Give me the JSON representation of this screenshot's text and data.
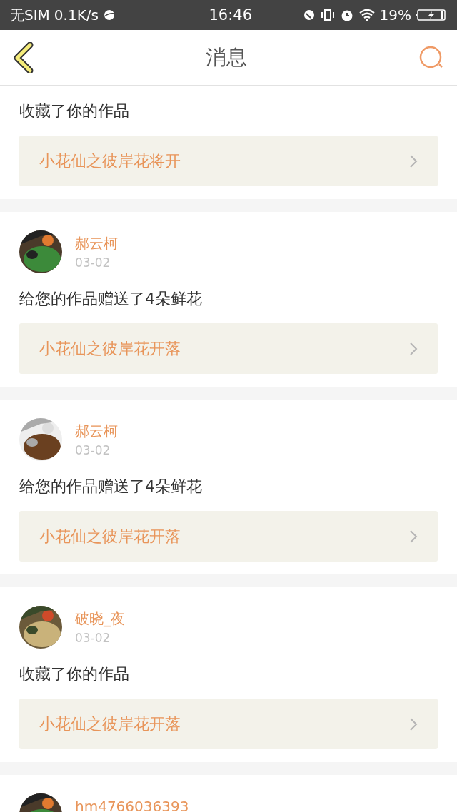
{
  "status_bar": {
    "carrier": "无SIM",
    "speed": "0.1K/s",
    "time": "16:46",
    "battery": "19%"
  },
  "header": {
    "title": "消息"
  },
  "messages": [
    {
      "text": "收藏了你的作品",
      "work": "小花仙之彼岸花将开"
    },
    {
      "user": {
        "name": "郝云柯",
        "date": "03-02"
      },
      "text": "给您的作品赠送了4朵鲜花",
      "work": "小花仙之彼岸花开落"
    },
    {
      "user": {
        "name": "郝云柯",
        "date": "03-02"
      },
      "text": "给您的作品赠送了4朵鲜花",
      "work": "小花仙之彼岸花开落"
    },
    {
      "user": {
        "name": "破晓_夜",
        "date": "03-02"
      },
      "text": "收藏了你的作品",
      "work": "小花仙之彼岸花开落"
    },
    {
      "user": {
        "name": "hm4766036393"
      }
    }
  ]
}
